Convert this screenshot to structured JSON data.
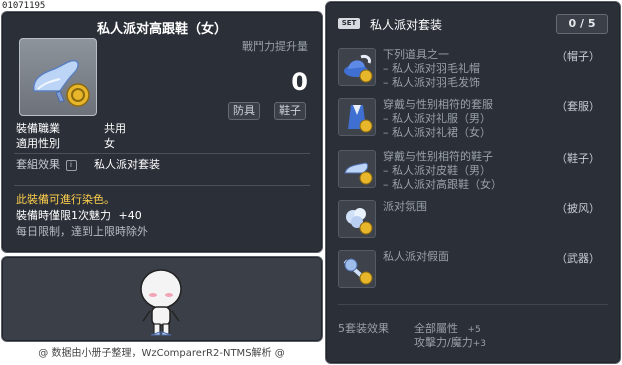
{
  "item_id": "01071195",
  "item": {
    "name": "私人派对高跟鞋（女）",
    "power_label": "戰鬥力提升量",
    "power_value": "0",
    "tags": [
      "防具",
      "鞋子"
    ],
    "stats": [
      {
        "key": "裝備職業",
        "value": "共用"
      },
      {
        "key": "適用性別",
        "value": "女"
      }
    ],
    "set_effect_label": "套組效果",
    "set_effect_value": "私人派对套装",
    "dye_note": "此裝備可進行染色。",
    "charm_label": "裝備時僅限1次魅力",
    "charm_value": "+40",
    "limit_note": "每日限制，達到上限時除外"
  },
  "footer": "@ 数据由小册子整理，WzComparerR2-NTMS解析 @",
  "set": {
    "badge": "SET",
    "name": "私人派对套装",
    "count": "0 / 5",
    "items": [
      {
        "lines": [
          "下列道具之一",
          "– 私人派对羽毛礼帽",
          "– 私人派对羽毛发饰"
        ],
        "category": "（帽子）",
        "icon": "feather-hat-icon"
      },
      {
        "lines": [
          "穿戴与性别相符的套服",
          "– 私人派对礼服（男）",
          "– 私人派对礼裙（女）"
        ],
        "category": "（套服）",
        "icon": "party-dress-icon"
      },
      {
        "lines": [
          "穿戴与性别相符的鞋子",
          "– 私人派对皮鞋（男）",
          "– 私人派对高跟鞋（女）"
        ],
        "category": "（鞋子）",
        "icon": "party-shoe-icon"
      },
      {
        "lines": [
          "派对氛围"
        ],
        "category": "（披风）",
        "icon": "party-cape-icon"
      },
      {
        "lines": [
          "私人派对假面"
        ],
        "category": "（武器）",
        "icon": "party-mask-icon"
      }
    ],
    "bonus_label": "5套装效果",
    "bonus_stats": [
      {
        "name": "全部屬性",
        "value": "+5"
      },
      {
        "name": "攻擊力/魔力",
        "value": "+3"
      }
    ]
  },
  "colors": {
    "panel_bg": "#2b2f38",
    "dye_note": "#ffd04b",
    "muted_text": "#9aa0a8"
  }
}
